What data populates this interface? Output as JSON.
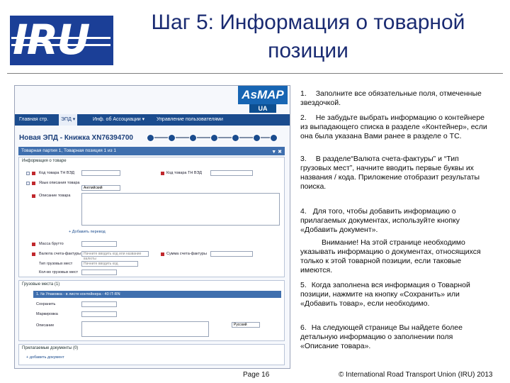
{
  "slide": {
    "logo_text": "IRU",
    "title": "Шаг 5: Информация о товарной позиции",
    "page_label": "Page 16",
    "copyright": "© International Road Transport Union (IRU) 2013"
  },
  "screenshot": {
    "brand_top": "AsMAP",
    "brand_bottom": "UA",
    "nav": [
      "Главная стр.",
      "ЭПД ▾",
      "Инф. об Ассоциации ▾",
      "Управление пользователями"
    ],
    "doc_title": "Новая ЭПД - Книжка XN76394700",
    "item_bar": "Товарная партия 1, Товарная позиция 1 из 1",
    "section_goods": "Информация о товаре",
    "fields": {
      "hs_code": "Код товара ТН ВЭД",
      "hs_code_tnved": "Код товара ТН ВЭД",
      "language": "Язык описания товара",
      "language_value": "Английский",
      "description": "Описание товара",
      "add_translation": "+ Добавить перевод",
      "gross_mass": "Масса брутто",
      "invoice_currency": "Валюта счета-фактуры",
      "invoice_currency_placeholder": "Начните вводить код или название валюты",
      "invoice_amount": "Сумма счета-фактуры",
      "package_type": "Тип грузовых мест",
      "package_type_placeholder": "Начните вводить код",
      "package_count": "Кол-во грузовых мест"
    },
    "section_container": "Грузовые места (1)",
    "container_bar": "1. № Упаковка - в листе контейнера - 40 IT-RN",
    "container_labels": [
      "Сохранить",
      "Маркировка",
      "Описание"
    ],
    "container_select": "Русский",
    "section_docs": "Прилагаемые документы (0)",
    "add_document": "+ добавить документ"
  },
  "instructions": [
    {
      "n": "1.",
      "text": "Заполните все обязательные поля, отмеченные звездочкой."
    },
    {
      "n": "2.",
      "text": "Не забудьте выбрать информацию о контейнере  из выпадающего списка в разделе «Контейнер», если она была указана Вами ранее в разделе о ТС."
    },
    {
      "n": "3.",
      "text": "В разделе“Валюта счета-фактуры” и “Тип грузовых мест”, начните вводить первые буквы их названия / кода. Приложение отобразит результаты поиска."
    },
    {
      "n": "4.",
      "text": "Для того, чтобы добавить информацию о прилагаемых документах, используйте кнопку «Добавить документ»."
    },
    {
      "n": "",
      "text": "Внимание! На этой странице необходимо указывать информацию о документах, относящихся только к этой товарной позиции, если таковые имеются."
    },
    {
      "n": "5.",
      "text": "Когда заполнена вся информация о Товарной позиции, нажмите на кнопку «Сохранить» или «Добавить товар», если необходимо."
    },
    {
      "n": "6.",
      "text": "На следующей странице Вы найдете более детальную информацию о заполнении поля «Описание товара»."
    }
  ],
  "colors": {
    "brand_blue": "#1b3f97",
    "title_blue": "#1a2b72",
    "nav_blue": "#1b4c8e",
    "required_red": "#c0282d"
  }
}
